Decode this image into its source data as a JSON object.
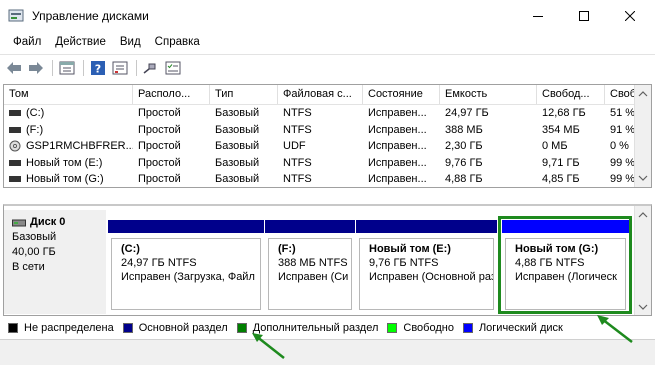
{
  "window": {
    "title": "Управление дисками"
  },
  "menu": [
    "Файл",
    "Действие",
    "Вид",
    "Справка"
  ],
  "volumes": {
    "columns": [
      "Том",
      "Располо...",
      "Тип",
      "Файловая с...",
      "Состояние",
      "Емкость",
      "Свобод...",
      "Своб"
    ],
    "rows": [
      [
        "(C:)",
        "Простой",
        "Базовый",
        "NTFS",
        "Исправен...",
        "24,97 ГБ",
        "12,68 ГБ",
        "51 %"
      ],
      [
        "(F:)",
        "Простой",
        "Базовый",
        "NTFS",
        "Исправен...",
        "388 МБ",
        "354 МБ",
        "91 %"
      ],
      [
        "GSP1RMCHBFRER...",
        "Простой",
        "Базовый",
        "UDF",
        "Исправен...",
        "2,30 ГБ",
        "0 МБ",
        "0 %"
      ],
      [
        "Новый том (E:)",
        "Простой",
        "Базовый",
        "NTFS",
        "Исправен...",
        "9,76 ГБ",
        "9,71 ГБ",
        "99 %"
      ],
      [
        "Новый том (G:)",
        "Простой",
        "Базовый",
        "NTFS",
        "Исправен...",
        "4,88 ГБ",
        "4,85 ГБ",
        "99 %"
      ]
    ]
  },
  "disk": {
    "name": "Диск 0",
    "type": "Базовый",
    "size": "40,00 ГБ",
    "status": "В сети",
    "partitions": [
      {
        "title": "(C:)",
        "size": "24,97 ГБ NTFS",
        "status": "Исправен (Загрузка, Файл"
      },
      {
        "title": "(F:)",
        "size": "388 МБ NTFS",
        "status": "Исправен (Си"
      },
      {
        "title": "Новый том (E:)",
        "size": "9,76 ГБ NTFS",
        "status": "Исправен (Основной разд"
      },
      {
        "title": "Новый том (G:)",
        "size": "4,88 ГБ NTFS",
        "status": "Исправен (Логическ"
      }
    ]
  },
  "legend": [
    {
      "label": "Не распределена",
      "color": "#000000"
    },
    {
      "label": "Основной раздел",
      "color": "#00008b"
    },
    {
      "label": "Дополнительный раздел",
      "color": "#007f00"
    },
    {
      "label": "Свободно",
      "color": "#00ff00"
    },
    {
      "label": "Логический диск",
      "color": "#0000ff"
    }
  ],
  "colors": {
    "highlight": "#1e8a1e",
    "primary": "#00008b",
    "logical": "#0000ff"
  }
}
